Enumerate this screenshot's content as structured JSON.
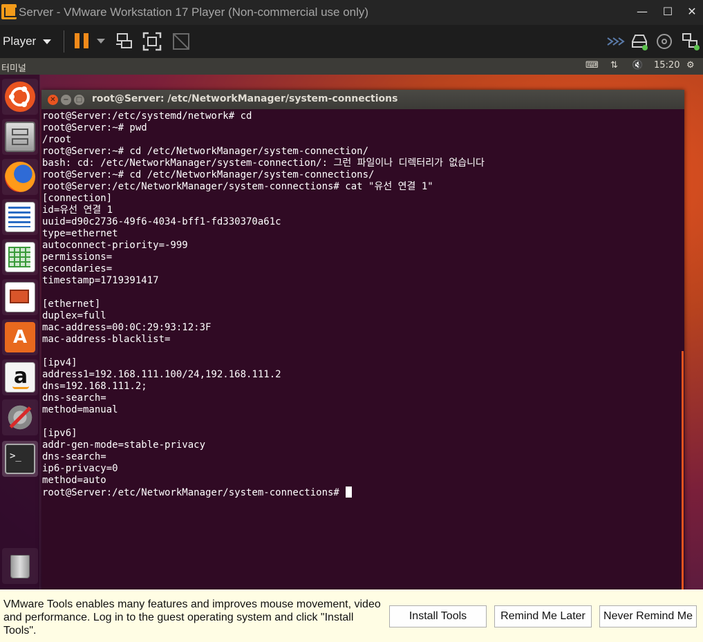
{
  "window": {
    "title": "Server - VMware Workstation 17 Player (Non-commercial use only)",
    "minimize": "—",
    "maximize": "☐",
    "close": "✕"
  },
  "toolbar": {
    "player_label": "Player"
  },
  "ubuntu_panel": {
    "app_name": "터미널",
    "keyboard_icon": "⌨",
    "network_icon": "⇅",
    "sound_icon": "🔇",
    "time": "15:20",
    "settings_icon": "⚙"
  },
  "terminal": {
    "title": "root@Server: /etc/NetworkManager/system-connections",
    "lines": [
      "root@Server:/etc/systemd/network# cd",
      "root@Server:~# pwd",
      "/root",
      "root@Server:~# cd /etc/NetworkManager/system-connection/",
      "bash: cd: /etc/NetworkManager/system-connection/: 그런 파일이나 디렉터리가 없습니다",
      "root@Server:~# cd /etc/NetworkManager/system-connections/",
      "root@Server:/etc/NetworkManager/system-connections# cat \"유선 연결 1\"",
      "[connection]",
      "id=유선 연결 1",
      "uuid=d90c2736-49f6-4034-bff1-fd330370a61c",
      "type=ethernet",
      "autoconnect-priority=-999",
      "permissions=",
      "secondaries=",
      "timestamp=1719391417",
      "",
      "[ethernet]",
      "duplex=full",
      "mac-address=00:0C:29:93:12:3F",
      "mac-address-blacklist=",
      "",
      "[ipv4]",
      "address1=192.168.111.100/24,192.168.111.2",
      "dns=192.168.111.2;",
      "dns-search=",
      "method=manual",
      "",
      "[ipv6]",
      "addr-gen-mode=stable-privacy",
      "dns-search=",
      "ip6-privacy=0",
      "method=auto"
    ],
    "prompt": "root@Server:/etc/NetworkManager/system-connections# "
  },
  "tools_bar": {
    "message": "VMware Tools enables many features and improves mouse movement, video and performance. Log in to the guest operating system and click \"Install Tools\".",
    "install_label": "Install Tools",
    "remind_label": "Remind Me Later",
    "never_label": "Never Remind Me"
  },
  "colors": {
    "terminal_bg": "#300a24",
    "ubuntu_orange": "#e95420",
    "vmware_orange": "#f28a1a"
  }
}
